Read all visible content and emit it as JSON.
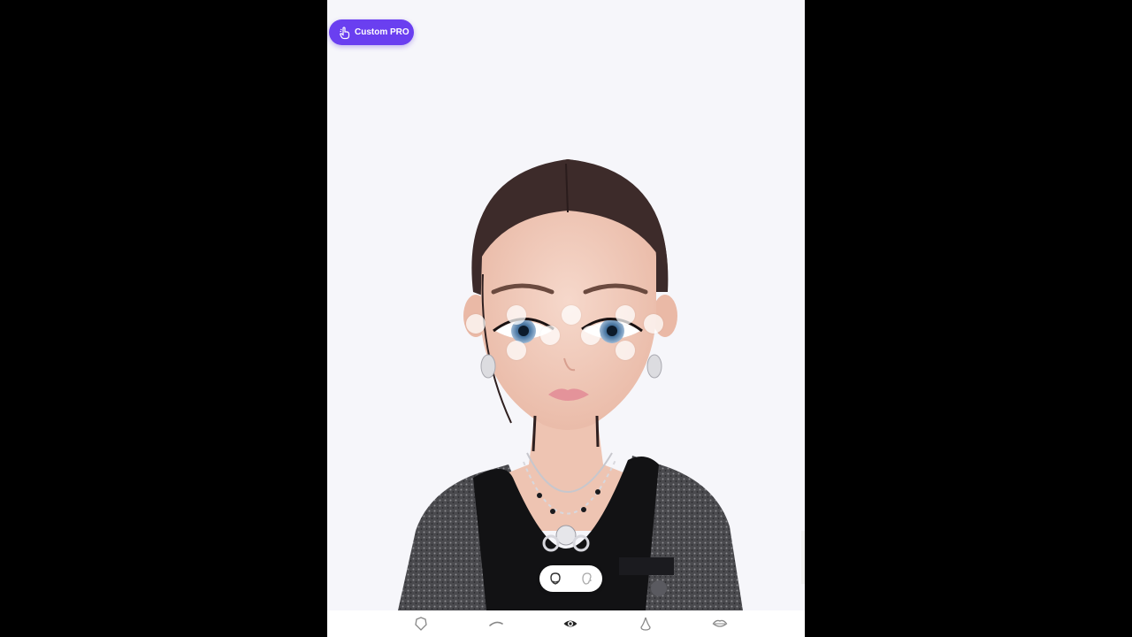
{
  "header": {
    "pro_button_label": "Custom PRO",
    "pro_icon": "hand-pointer-icon"
  },
  "toggle": {
    "items": [
      {
        "name": "face-front-icon",
        "selected": true
      },
      {
        "name": "face-side-icon",
        "selected": false
      }
    ]
  },
  "bottom_nav": {
    "items": [
      {
        "name": "face-shape-icon",
        "selected": false
      },
      {
        "name": "eyebrow-icon",
        "selected": false
      },
      {
        "name": "eye-icon",
        "selected": true
      },
      {
        "name": "nose-icon",
        "selected": false
      },
      {
        "name": "lips-icon",
        "selected": false
      }
    ]
  },
  "colors": {
    "accent": "#6a3ff0",
    "background": "#f6f6fa"
  }
}
